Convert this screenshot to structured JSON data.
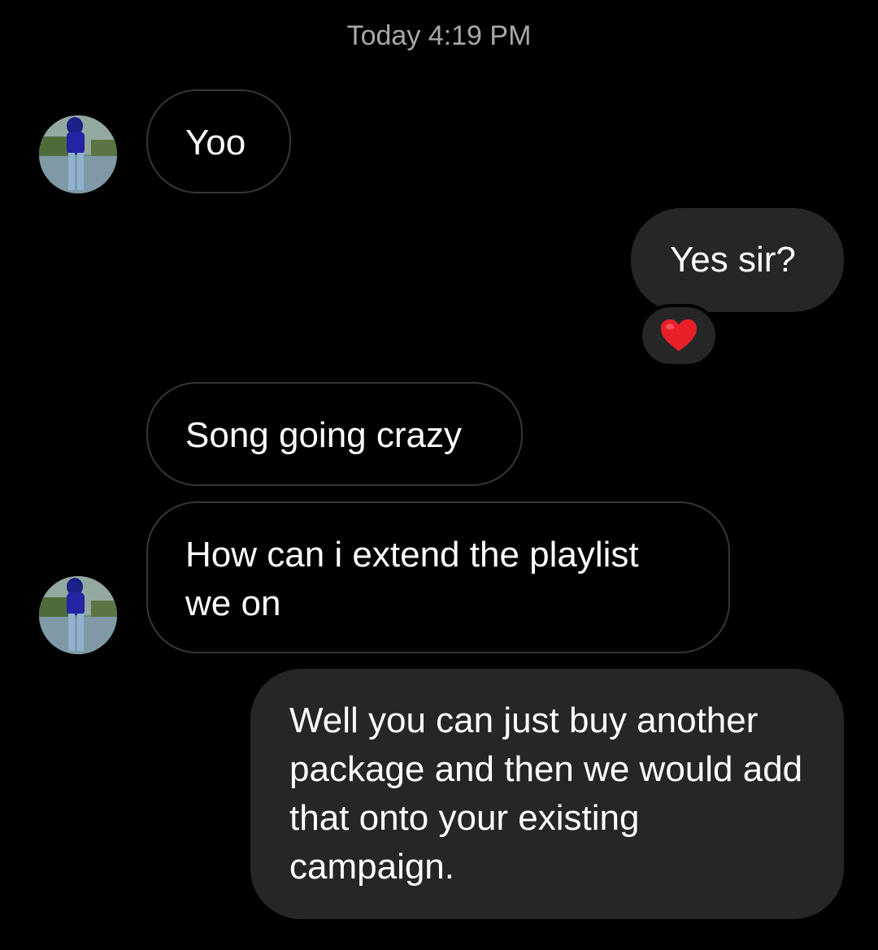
{
  "conversation": {
    "timestamp": "Today 4:19 PM",
    "messages": [
      {
        "direction": "incoming",
        "text": "Yoo"
      },
      {
        "direction": "outgoing",
        "text": "Yes sir?",
        "reaction": "heart"
      },
      {
        "direction": "incoming",
        "text": "Song going crazy"
      },
      {
        "direction": "incoming",
        "text": "How can i extend the playlist we on"
      },
      {
        "direction": "outgoing",
        "text": "Well you can just buy another package and then we would add that onto your existing campaign."
      }
    ]
  },
  "icons": {
    "reaction": "heart-icon",
    "avatar": "contact-avatar"
  },
  "colors": {
    "background": "#000000",
    "incoming_border": "#363636",
    "outgoing_bubble": "#262626",
    "timestamp_text": "#a8a8a8",
    "reaction_heart": "#e8202a"
  }
}
